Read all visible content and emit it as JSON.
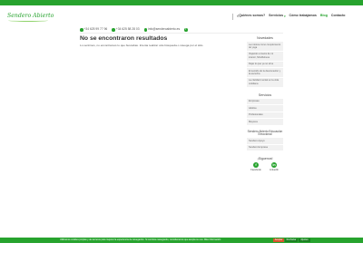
{
  "header": {
    "logo_text": "Sendero Abierto",
    "nav": [
      {
        "label": "¿Quiénes somos?",
        "chevron": false,
        "active": false
      },
      {
        "label": "Servicios",
        "chevron": true,
        "active": false
      },
      {
        "label": "Cómo trabajamos",
        "chevron": false,
        "active": false
      },
      {
        "label": "Blog",
        "chevron": false,
        "active": true
      },
      {
        "label": "Contacto",
        "chevron": false,
        "active": false
      }
    ]
  },
  "contact": {
    "phone_mobile": "+34 625 99 77 96",
    "phone_landline": "+34 625 58 28 03",
    "email": "info@senderoabierto.es",
    "facebook_glyph": "f"
  },
  "main": {
    "title": "No se encontraron resultados",
    "text": "Lo sentimos, no encontramos lo que buscabas. Intenta realizar otra búsqueda o navega por el sitio."
  },
  "sidebar": {
    "recent_title": "Novedades",
    "recent_posts": [
      "La música como complemento de yoga",
      "Viajando a través de mi interior, Mindfulness",
      "Dejar lo que ya no sirve",
      "El sentido de la desconexión y la escucha",
      "La claridad mental en la vida cotidiana"
    ],
    "services_title": "Servicios",
    "services": [
      "Empresas",
      "Adultos",
      "Profesionales",
      "Mayores"
    ],
    "edu_title": "Sendero Abierto Educación Emocional",
    "edu_items": [
      "Sendero Apoyo",
      "Sendero Empresa"
    ],
    "follow_title": "¡Síguenos!",
    "social": [
      {
        "glyph": "f",
        "label": "Facebook",
        "icon": "facebook-icon"
      },
      {
        "glyph": "in",
        "label": "LinkedIn",
        "icon": "linkedin-icon"
      }
    ]
  },
  "cookie": {
    "text": "Utilizamos cookies propias y de terceros para mejorar la experiencia de navegación. Si continúa navegando, consideramos que acepta su uso. Más información",
    "accept": "Aceptar",
    "reject": "Rechazar",
    "more": "Ajustes"
  },
  "colors": {
    "brand_green": "#27a32e",
    "dark_green": "#1b7f22",
    "accept_orange": "#d8522a"
  }
}
